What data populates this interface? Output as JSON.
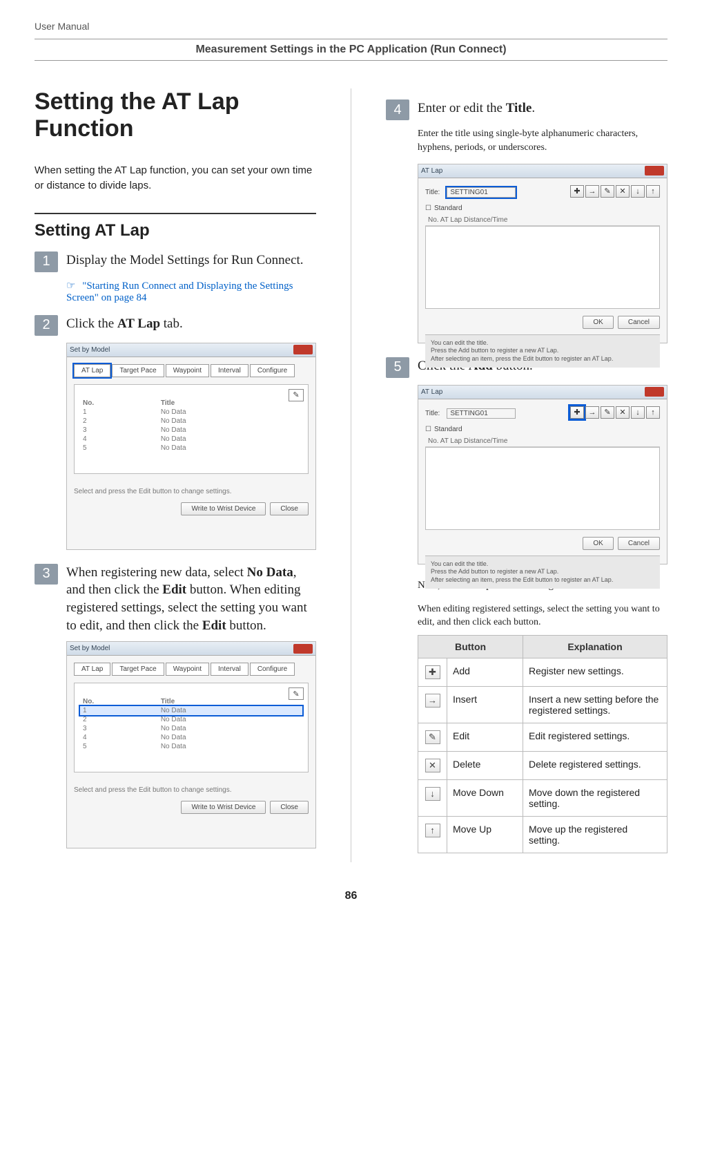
{
  "header_label": "User Manual",
  "section_header": "Measurement Settings in the PC Application (Run Connect)",
  "page_number": "86",
  "left": {
    "h1": "Setting the AT Lap Function",
    "intro": "When setting the AT Lap function, you can set your own time or distance to divide laps.",
    "h2": "Setting AT Lap",
    "step1": {
      "num": "1",
      "text": "Display the Model Settings for Run Connect.",
      "link_icon": "☞",
      "link": " \"Starting Run Connect and Displaying the Settings Screen\" on page 84"
    },
    "step2": {
      "num": "2",
      "text_pre": "Click the ",
      "text_bold": "AT Lap",
      "text_post": " tab."
    },
    "step3": {
      "num": "3",
      "text_a": "When registering new data, select ",
      "text_b_bold": "No Data",
      "text_c": ", and then click the ",
      "text_d_bold": "Edit",
      "text_e": " button. When editing registered settings, select the setting you want to edit, and then click the ",
      "text_f_bold": "Edit",
      "text_g": " button."
    },
    "dialog": {
      "title": "Set by Model",
      "tabs": [
        "AT Lap",
        "Target Pace",
        "Waypoint",
        "Interval",
        "Configure"
      ],
      "edit_glyph": "✎",
      "list_cols": [
        "No.",
        "Title"
      ],
      "rows": [
        {
          "no": "1",
          "title": "No Data"
        },
        {
          "no": "2",
          "title": "No Data"
        },
        {
          "no": "3",
          "title": "No Data"
        },
        {
          "no": "4",
          "title": "No Data"
        },
        {
          "no": "5",
          "title": "No Data"
        }
      ],
      "footer_note": "Select and press the Edit button to change settings.",
      "btn_write": "Write to Wrist Device",
      "btn_close": "Close"
    }
  },
  "right": {
    "step4": {
      "num": "4",
      "text_pre": "Enter or edit the ",
      "text_bold": "Title",
      "text_post": ".",
      "sub": "Enter the title using single-byte alphanumeric characters, hyphens, periods, or underscores."
    },
    "step5": {
      "num": "5",
      "text_pre": "Click the ",
      "text_bold": "Add",
      "text_post": " button."
    },
    "next_text": "Next, we will explain how to register new data.",
    "edit_note": "When editing registered settings, select the setting you want to edit, and then click each button.",
    "atlap_dialog": {
      "title": "AT Lap",
      "title_label": "Title:",
      "title_value": "SETTING01",
      "standard_label": "Standard",
      "toolbar": {
        "add": "✚",
        "insert": "→",
        "edit": "✎",
        "delete": "✕",
        "down": "↓",
        "up": "↑"
      },
      "list_header": "No.   AT Lap Distance/Time",
      "btn_ok": "OK",
      "btn_cancel": "Cancel",
      "note_line1": "You can edit the title.",
      "note_line2": "Press the Add button to register a new AT Lap.",
      "note_line3": "After selecting an item, press the Edit button to register an AT Lap."
    },
    "table": {
      "head_button": "Button",
      "head_expl": "Explanation",
      "rows": [
        {
          "icon": "✚",
          "name": "Add",
          "expl": "Register new settings."
        },
        {
          "icon": "→",
          "name": "Insert",
          "expl": "Insert a new setting before the registered settings."
        },
        {
          "icon": "✎",
          "name": "Edit",
          "expl": "Edit registered settings."
        },
        {
          "icon": "✕",
          "name": "Delete",
          "expl": "Delete registered settings."
        },
        {
          "icon": "↓",
          "name": "Move Down",
          "expl": "Move down the registered setting."
        },
        {
          "icon": "↑",
          "name": "Move Up",
          "expl": "Move up the registered setting."
        }
      ]
    }
  }
}
